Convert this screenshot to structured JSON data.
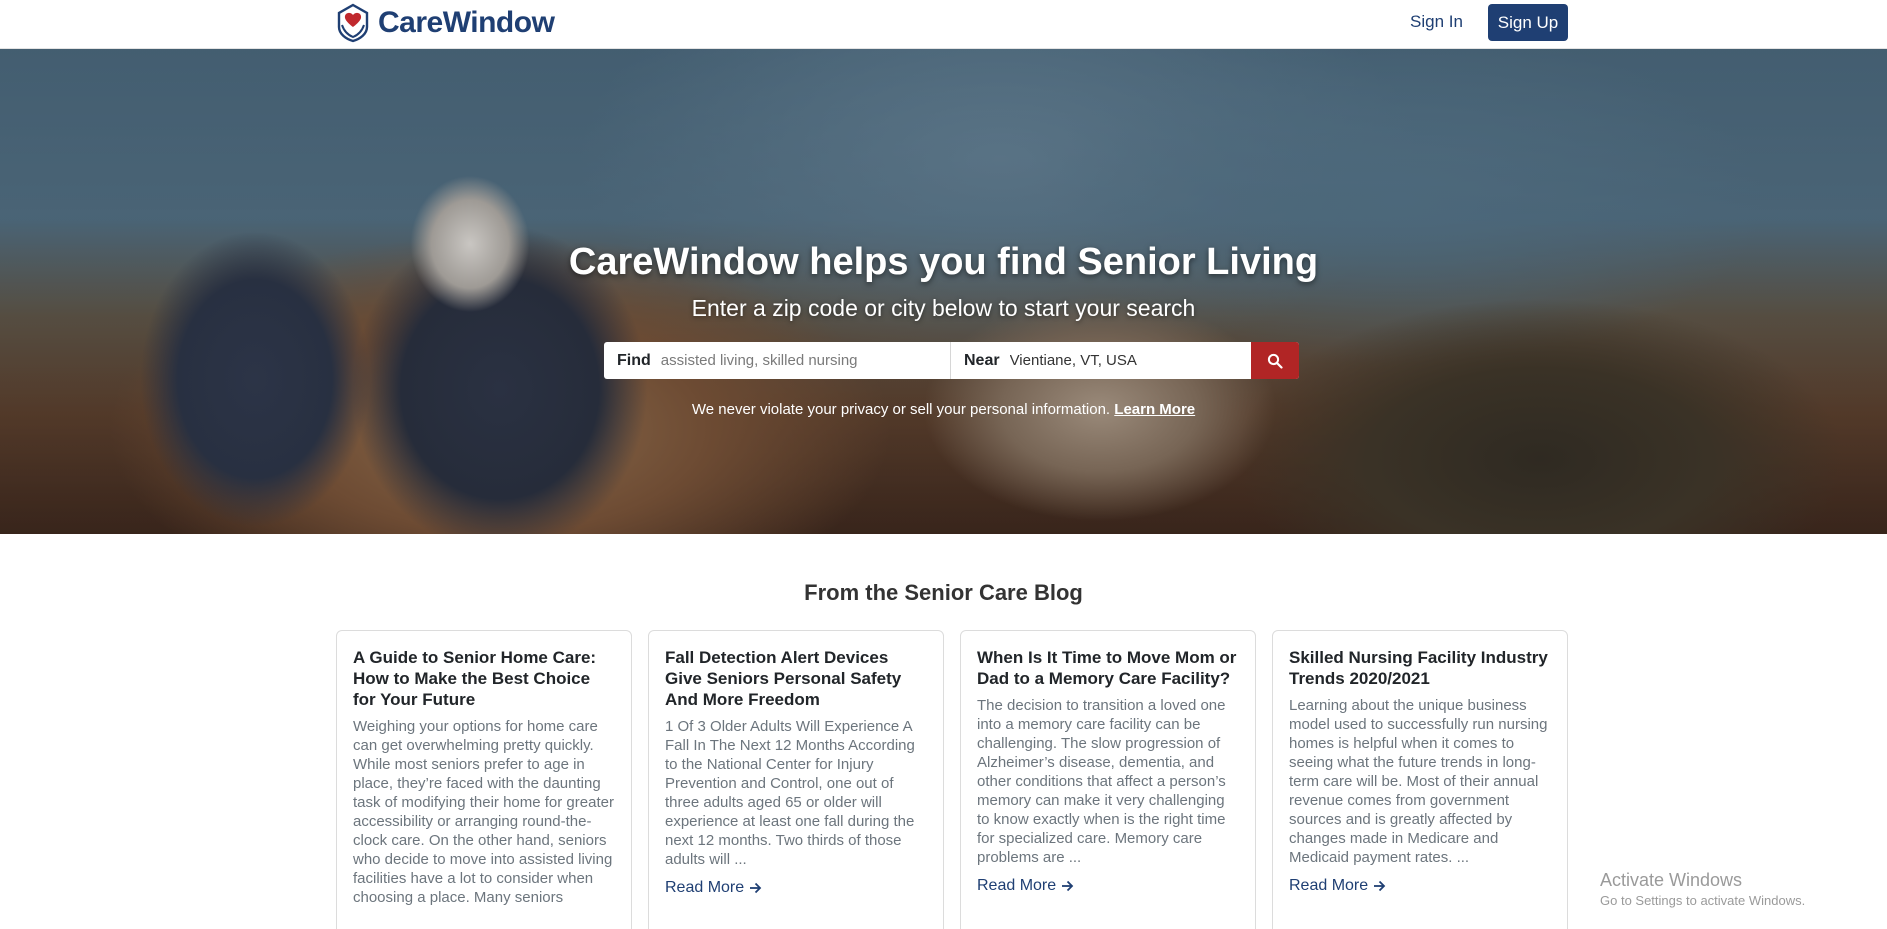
{
  "header": {
    "brand": "CareWindow",
    "sign_in": "Sign In",
    "sign_up": "Sign Up"
  },
  "hero": {
    "title": "CareWindow helps you find Senior Living",
    "subtitle": "Enter a zip code or city below to start your search",
    "search": {
      "find_label": "Find",
      "find_placeholder": "assisted living, skilled nursing",
      "near_label": "Near",
      "near_value": "Vientiane, VT, USA",
      "button_icon": "search-icon"
    },
    "privacy": {
      "text": "We never violate your privacy or sell your personal information.",
      "link": "Learn More"
    }
  },
  "blog": {
    "title": "From the Senior Care Blog",
    "read_more": "Read More",
    "cards": [
      {
        "title": "A Guide to Senior Home Care: How to Make the Best Choice for Your Future",
        "excerpt": "Weighing your options for home care can get overwhelming pretty quickly. While most seniors prefer to age in place, they’re faced with the daunting task of modifying their home for greater accessibility or arranging round-the-clock care. On the other hand, seniors who decide to move into assisted living facilities have a lot to consider when choosing a place. Many seniors"
      },
      {
        "title": "Fall Detection Alert Devices Give Seniors Personal Safety And More Freedom",
        "excerpt": "1 Of 3 Older Adults Will Experience A Fall In The Next 12 Months According to the National Center for Injury Prevention and Control, one out of three adults aged 65 or older will experience at least one fall during the next 12 months. Two thirds of those adults will ..."
      },
      {
        "title": "When Is It Time to Move Mom or Dad to a Memory Care Facility?",
        "excerpt": "The decision to transition a loved one into a memory care facility can be challenging. The slow progression of Alzheimer’s disease, dementia, and other conditions that affect a person’s memory can make it very challenging to know exactly when is the right time for specialized care. Memory care problems are ..."
      },
      {
        "title": "Skilled Nursing Facility Industry Trends 2020/2021",
        "excerpt": "Learning about the unique business model used to successfully run nursing homes is helpful when it comes to seeing what the future trends in long-term care will be. Most of their annual revenue comes from government sources and is greatly affected by changes made in Medicare and Medicaid payment rates. ..."
      }
    ]
  },
  "watermark": {
    "line1": "Activate Windows",
    "line2": "Go to Settings to activate Windows."
  },
  "colors": {
    "brand_navy": "#1f3f73",
    "search_button": "#b12525"
  }
}
